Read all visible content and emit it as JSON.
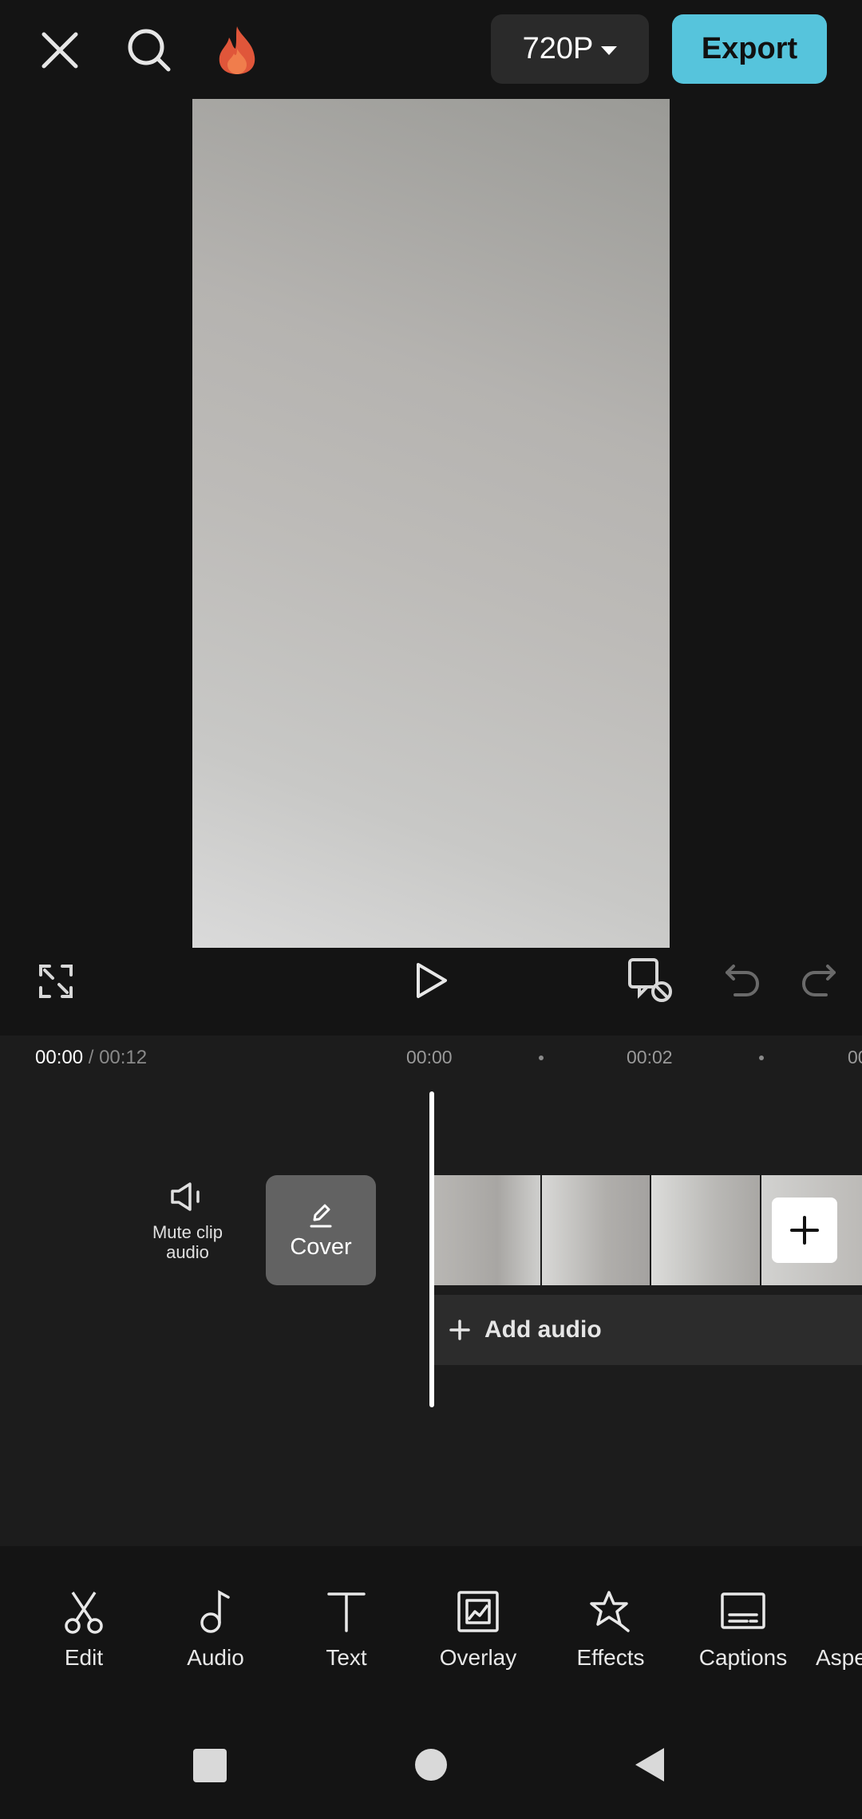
{
  "top_bar": {
    "close_icon": "close-icon",
    "search_icon": "search-icon",
    "fire_icon": "fire-icon",
    "resolution": "720P",
    "export_label": "Export",
    "accent_color": "#56c4dc"
  },
  "controls": {
    "fullscreen_icon": "fullscreen-icon",
    "play_icon": "play-icon",
    "keyframe_icon": "keyframe-icon",
    "undo_icon": "undo-icon",
    "redo_icon": "redo-icon"
  },
  "timeline": {
    "current_time": "00:00",
    "total_time": " / 00:12",
    "ruler": [
      "00:00",
      "00:02",
      "00"
    ],
    "mute_label": "Mute clip audio",
    "cover_label": "Cover",
    "add_audio_label": "Add audio"
  },
  "toolbar": {
    "items": [
      {
        "label": "Edit",
        "icon": "scissors-icon"
      },
      {
        "label": "Audio",
        "icon": "music-note-icon"
      },
      {
        "label": "Text",
        "icon": "text-icon"
      },
      {
        "label": "Overlay",
        "icon": "overlay-icon"
      },
      {
        "label": "Effects",
        "icon": "effects-star-icon"
      },
      {
        "label": "Captions",
        "icon": "captions-icon"
      },
      {
        "label": "Aspe",
        "icon": "aspect-icon"
      }
    ]
  }
}
